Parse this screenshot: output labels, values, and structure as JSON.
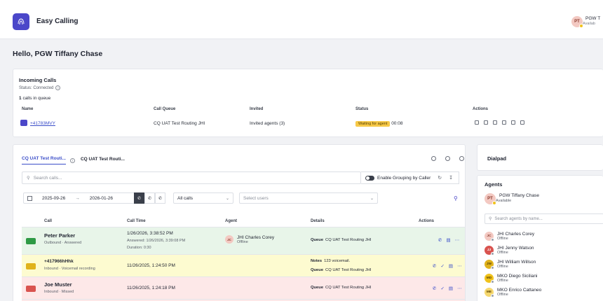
{
  "app": {
    "title": "Easy Calling"
  },
  "user": {
    "initials": "PT",
    "name": "PGW T",
    "status": "Availab",
    "greeting": "Hello, PGW Tiffany Chase"
  },
  "incoming": {
    "title": "Incoming Calls",
    "status": "Status: Connected",
    "count": "1",
    "count_suffix": "calls in queue",
    "headers": [
      "Name",
      "Call Queue",
      "Invited",
      "Status",
      "Actions"
    ],
    "row": {
      "name": "+41783MVY",
      "queue": "CQ UAT Test Routing JHI",
      "invited": "Invited agents (3)",
      "status": "Waiting for agent",
      "time": "00:08"
    }
  },
  "tabs": [
    {
      "label": "CQ UAT Test Routi..."
    },
    {
      "label": "CQ UAT Test Routi..."
    }
  ],
  "toolbar": {
    "search_placeholder": "Search calls...",
    "grouping_label": "Enable Grouping by Caller"
  },
  "filters": {
    "date_from": "2025-09-26",
    "date_to": "2026-01-26",
    "date_arrow": "→",
    "calls": "All calls",
    "users_placeholder": "Select users"
  },
  "table": {
    "headers": {
      "call": "Call",
      "time": "Call Time",
      "agent": "Agent",
      "details": "Details",
      "actions": "Actions"
    },
    "rows": [
      {
        "name": "Peter Parker",
        "sub": "Outbound · Answered",
        "time": "1/26/2026, 3:38:52 PM",
        "answered": "Answered: 1/26/2026, 3:39:08 PM",
        "duration": "Duration: 0:30",
        "agent_initials": "JC",
        "agent": "JHI Charles Corey",
        "agent_status": "Offline",
        "queue_label": "Queue",
        "queue": "CQ UAT Test Routing JHI",
        "color": "#2e9a45"
      },
      {
        "name": "+417966hHhk",
        "sub": "Inbound · Voicemail recording",
        "time": "11/26/2025, 1:24:50 PM",
        "notes_label": "Notes",
        "notes": "123 voicemail.",
        "queue_label": "Queue",
        "queue": "CQ UAT Test Routing JHI",
        "color": "#e0b21b"
      },
      {
        "name": "Joe Muster",
        "sub": "Inbound · Missed",
        "time": "11/26/2025, 1:24:18 PM",
        "queue_label": "Queue",
        "queue": "CQ UAT Test Routing JHI",
        "color": "#d9534f"
      }
    ]
  },
  "dialpad": {
    "title": "Dialpad"
  },
  "agents": {
    "title": "Agents",
    "me": {
      "initials": "PT",
      "name": "PGW Tiffany Chase",
      "status": "Available"
    },
    "search_placeholder": "Search agents by name...",
    "list": [
      {
        "initials": "JC",
        "name": "JHI Charles Corey",
        "status": "Offline",
        "bg": "#f3c9c2",
        "fg": "#8a3b2e"
      },
      {
        "initials": "JJ",
        "name": "JHI Jenny Watson",
        "status": "Offline",
        "bg": "#d9534f",
        "fg": "#ffffff"
      },
      {
        "initials": "JW",
        "name": "JHI William Willson",
        "status": "Offline",
        "bg": "#e0b21b",
        "fg": "#5a4200"
      },
      {
        "initials": "MD",
        "name": "MKO Diego Siciliani",
        "status": "Offline",
        "bg": "#f0c21b",
        "fg": "#5a4200"
      },
      {
        "initials": "ME",
        "name": "MKO Enrico Cattaneo",
        "status": "Offline",
        "bg": "#f5d76e",
        "fg": "#5a4200"
      }
    ]
  }
}
